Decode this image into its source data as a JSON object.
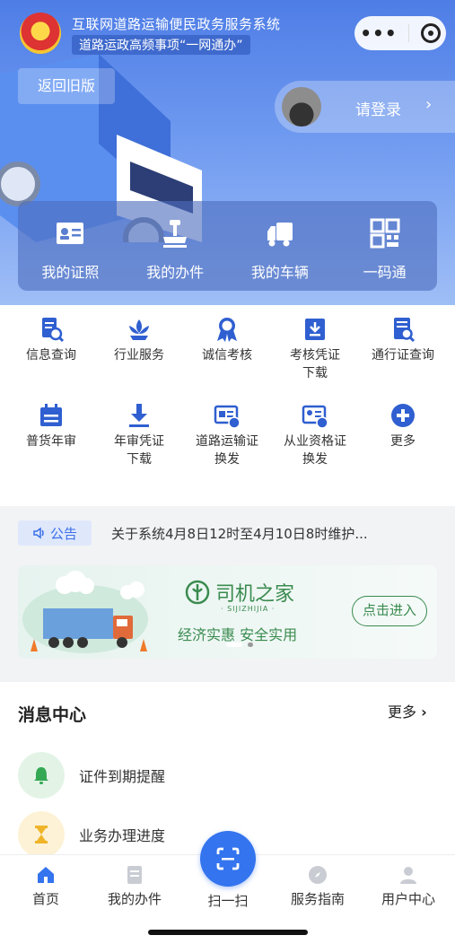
{
  "header": {
    "system_title": "互联网道路运输便民政务服务系统",
    "system_subtitle": "道路运政高频事项“一网通办”",
    "old_version_label": "返回旧版",
    "login_label": "请登录"
  },
  "quick_actions": [
    {
      "label": "我的证照",
      "icon": "id-card-icon"
    },
    {
      "label": "我的办件",
      "icon": "stamp-icon"
    },
    {
      "label": "我的车辆",
      "icon": "truck-icon"
    },
    {
      "label": "一码通",
      "icon": "qr-code-icon"
    }
  ],
  "services": [
    {
      "label": "信息查询",
      "icon": "document-search-icon"
    },
    {
      "label": "行业服务",
      "icon": "lotus-icon"
    },
    {
      "label": "诚信考核",
      "icon": "medal-icon"
    },
    {
      "label": "考核凭证\n下载",
      "icon": "download-box-icon"
    },
    {
      "label": "通行证查询",
      "icon": "pass-search-icon"
    },
    {
      "label": "普货年审",
      "icon": "calendar-icon"
    },
    {
      "label": "年审凭证\n下载",
      "icon": "download-icon"
    },
    {
      "label": "道路运输证\n换发",
      "icon": "transport-cert-icon"
    },
    {
      "label": "从业资格证\n换发",
      "icon": "qualification-cert-icon"
    },
    {
      "label": "更多",
      "icon": "plus-circle-icon"
    }
  ],
  "notice": {
    "tag": "公告",
    "text": "关于系统4月8日12时至4月10日8时维护..."
  },
  "banner": {
    "brand_name": "司机之家",
    "brand_en": "· SIJIZHIJIA ·",
    "slogan": "经济实惠 安全实用",
    "button_label": "点击进入"
  },
  "messages": {
    "title": "消息中心",
    "more_label": "更多",
    "items": [
      {
        "label": "证件到期提醒",
        "icon": "bell-icon"
      },
      {
        "label": "业务办理进度",
        "icon": "hourglass-icon"
      }
    ]
  },
  "tabbar": {
    "items": [
      {
        "label": "首页",
        "icon": "home-icon"
      },
      {
        "label": "我的办件",
        "icon": "document-list-icon"
      },
      {
        "label": "扫一扫",
        "icon": "scan-icon"
      },
      {
        "label": "服务指南",
        "icon": "compass-icon"
      },
      {
        "label": "用户中心",
        "icon": "user-icon"
      }
    ]
  },
  "colors": {
    "brand_blue": "#3474ee",
    "hero_blue": "#4e7de6",
    "green": "#3a8b4f",
    "bell_green": "#34a853",
    "hourglass_yellow": "#f0b429"
  }
}
